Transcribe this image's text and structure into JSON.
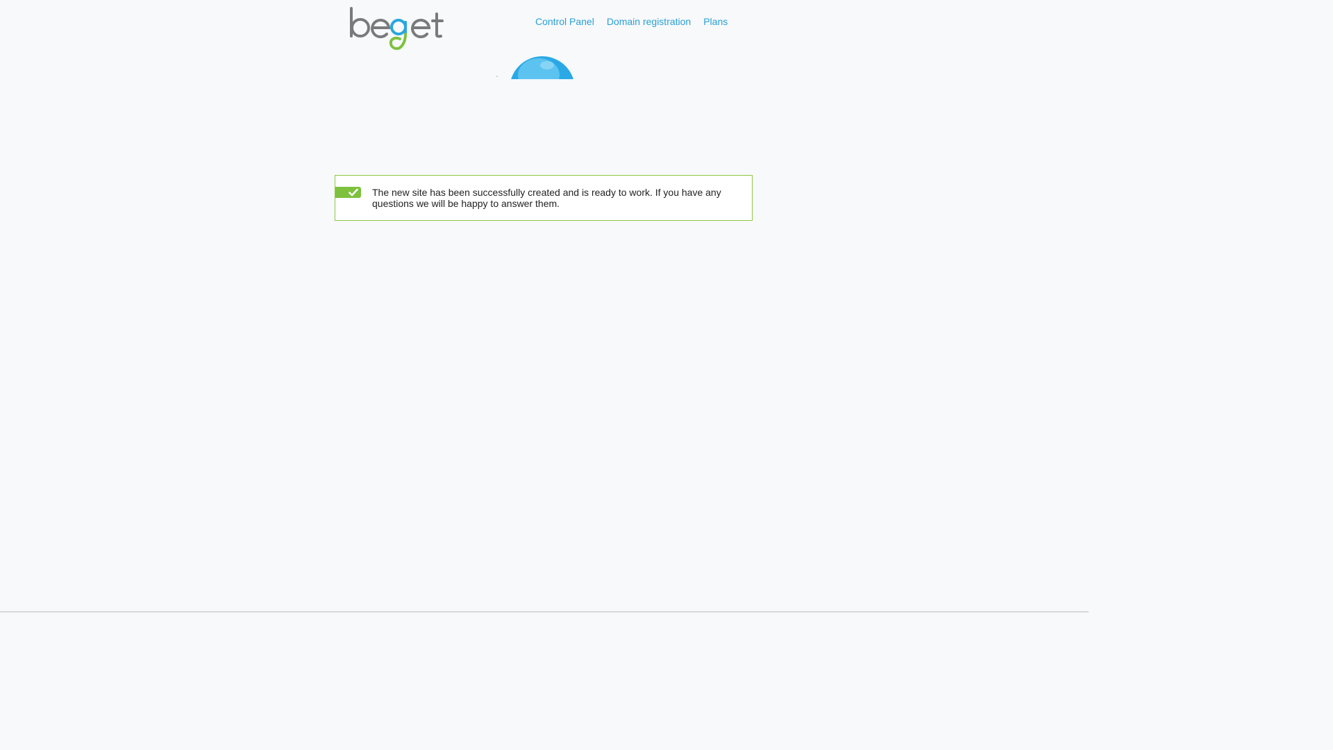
{
  "brand": {
    "logo_text": "beget",
    "colors": {
      "gray": "#7a7a7a",
      "blue": "#29a6e0",
      "green": "#7dc13f"
    }
  },
  "nav": {
    "items": [
      {
        "label": "Control Panel"
      },
      {
        "label": "Domain registration"
      },
      {
        "label": "Plans"
      }
    ],
    "link_color": "#2a9fd6"
  },
  "notice": {
    "icon": "checkmark-icon",
    "text": "The new site has been successfully created and is ready to work. If you have any questions we will be happy to answer them.",
    "border_color": "#8ec63f",
    "badge_color": "#7dc13f"
  },
  "decor": {
    "balloon_icon": "balloon-icon",
    "balloon_color": "#2aa9e6"
  }
}
